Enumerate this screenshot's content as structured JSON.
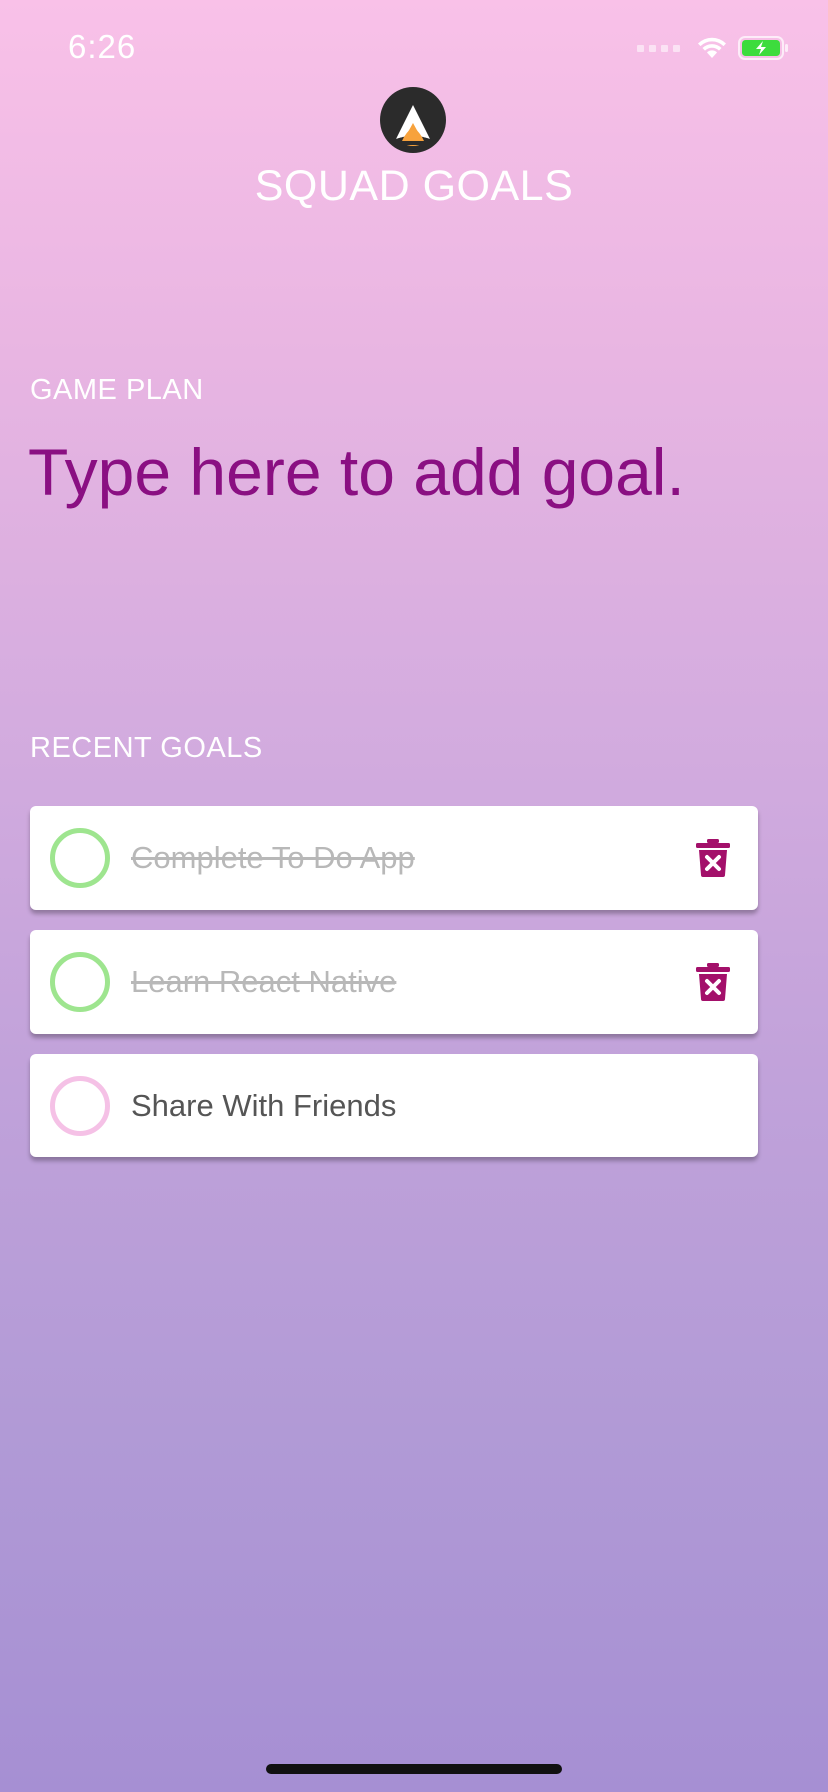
{
  "status_bar": {
    "time": "6:26",
    "icons": [
      "signal-icon",
      "wifi-icon",
      "battery-charging-icon"
    ],
    "battery_color": "#3ddc3d"
  },
  "header": {
    "logo_icon": "squad-logo-icon",
    "title": "SQUAD GOALS"
  },
  "game_plan": {
    "label": "GAME PLAN",
    "input_placeholder": "Type here to add goal.",
    "input_value": ""
  },
  "recent_goals": {
    "label": "RECENT GOALS",
    "items": [
      {
        "text": "Complete To Do App",
        "completed": true
      },
      {
        "text": "Learn React Native",
        "completed": true
      },
      {
        "text": "Share With Friends",
        "completed": false
      }
    ]
  },
  "colors": {
    "accent": "#8a0f82",
    "trash": "#a3106a",
    "complete_ring": "#9ee58f",
    "pending_ring": "#f5c1e6",
    "gradient_top": "#f9c1e8",
    "gradient_bottom": "#a68fd3"
  }
}
